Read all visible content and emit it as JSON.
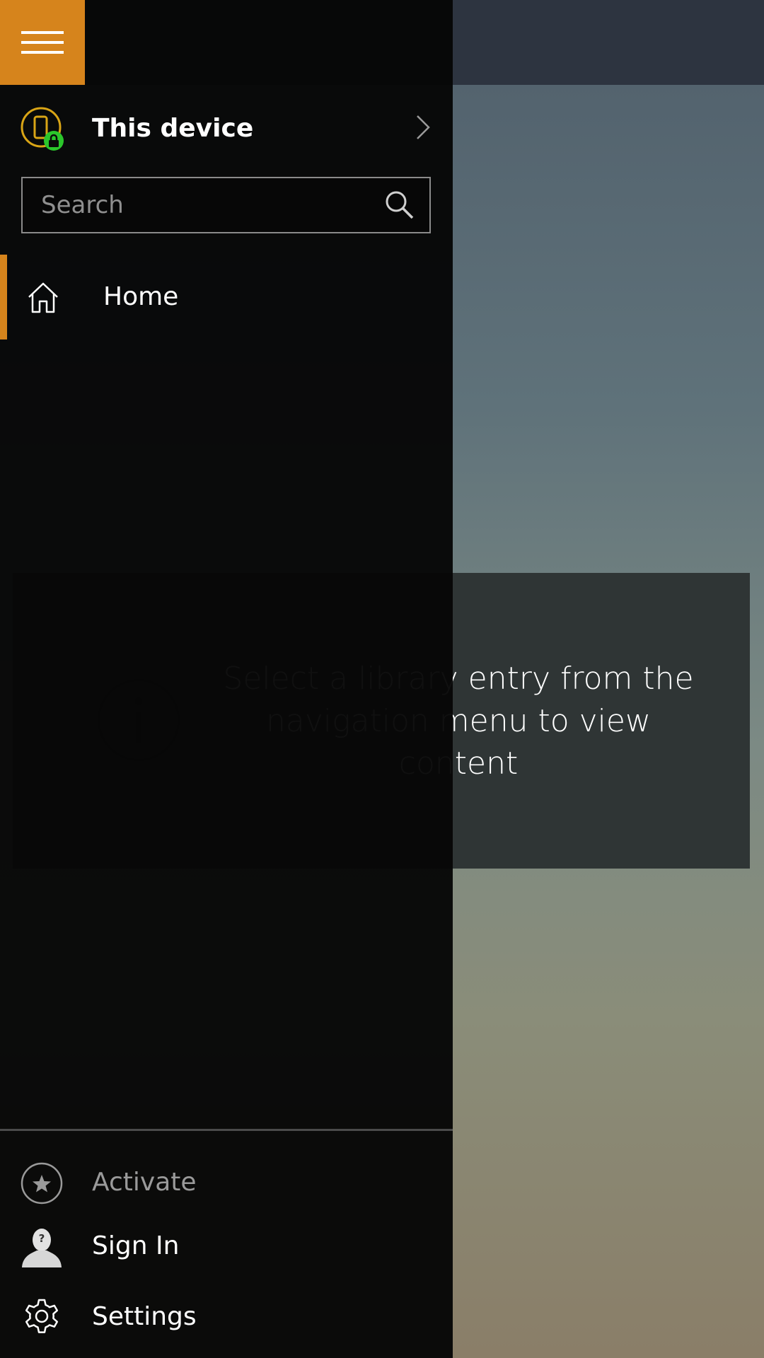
{
  "nav": {
    "device_label": "This device",
    "search": {
      "placeholder": "Search",
      "value": ""
    },
    "items": [
      {
        "label": "Home",
        "icon": "home-icon",
        "selected": true
      }
    ],
    "bottom_items": [
      {
        "label": "Activate",
        "icon": "star-circle-icon",
        "enabled": false
      },
      {
        "label": "Sign In",
        "icon": "user-silhouette-icon",
        "enabled": true
      },
      {
        "label": "Settings",
        "icon": "gear-icon",
        "enabled": true
      }
    ]
  },
  "main": {
    "info_message": "Select a library entry from the navigation menu to view content",
    "info_icon": "info-icon"
  },
  "colors": {
    "accent": "#d6841c",
    "device_ring": "#d9a516",
    "lock_badge": "#2bc62b",
    "nav_bg": "#060606",
    "header_bar": "#2d3440"
  },
  "icons": {
    "menu": "hamburger-icon",
    "device": "phone-lock-icon",
    "chevron": "chevron-right-icon",
    "search": "search-icon"
  }
}
